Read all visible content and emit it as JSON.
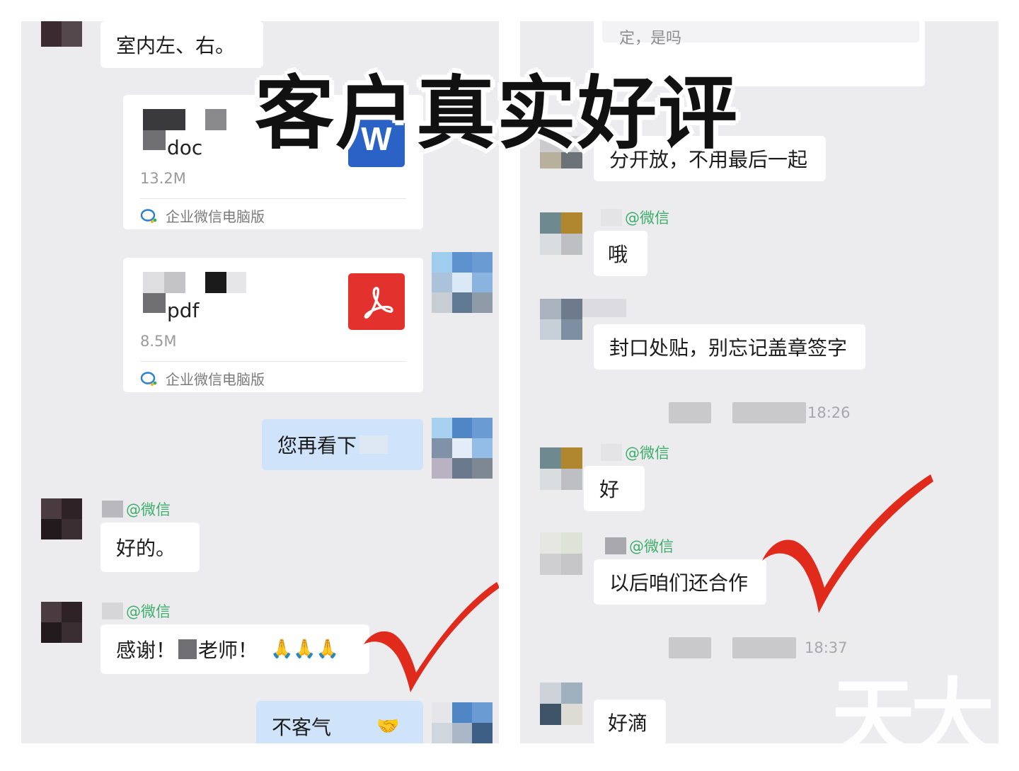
{
  "overlay": {
    "title": "客户真实好评",
    "watermark": "天大"
  },
  "left_panel": {
    "top_message": "室内左、右。",
    "files": [
      {
        "name": "doc",
        "size": "13.2M",
        "source": "企业微信电脑版",
        "icon": "word-icon",
        "icon_letter": "W"
      },
      {
        "name": "pdf",
        "size": "8.5M",
        "source": "企业微信电脑版",
        "icon": "pdf-icon"
      }
    ],
    "my_message_1": "您再看下",
    "sender_tag_1": "@微信",
    "reply_1": "好的。",
    "sender_tag_2": "@微信",
    "reply_2_prefix": "感谢！",
    "reply_2_suffix": "老师！",
    "reply_2_emoji": "🙏🙏🙏",
    "my_message_2": "不客气",
    "my_message_2_emoji": "🤝"
  },
  "right_panel": {
    "top_partial": "定，是吗",
    "message_1": "分开放，不用最后一起",
    "sender_tag_1": "@微信",
    "message_2": "哦",
    "message_3": "封口处贴，别忘记盖章签字",
    "time_1": "18:26",
    "sender_tag_2": "@微信",
    "message_4": "好",
    "sender_tag_3": "@微信",
    "message_5": "以后咱们还合作",
    "time_2": "18:37",
    "message_6": "好滴"
  },
  "colors": {
    "panel_bg": "#ececef",
    "bubble_bg": "#ffffff",
    "my_bubble_bg": "#cfe4fb",
    "sender_tag": "#3cae6a",
    "checkmark": "#e02a1b",
    "word_icon": "#2a63c5",
    "pdf_icon": "#e3312d"
  }
}
